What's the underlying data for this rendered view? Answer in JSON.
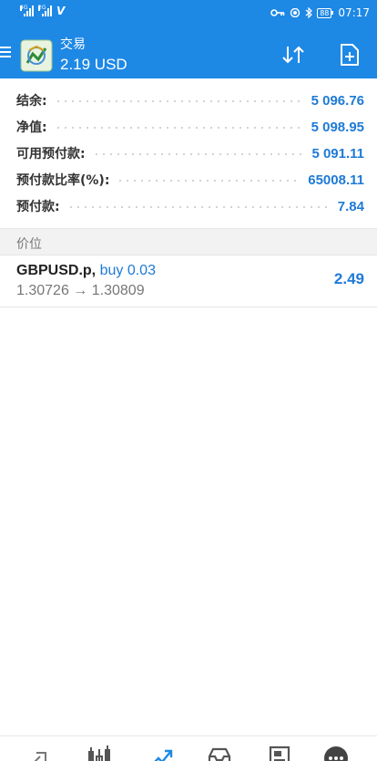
{
  "status_bar": {
    "signal_1_net": "4G",
    "signal_2_net": "2G",
    "battery": "88",
    "time": "07:17"
  },
  "toolbar": {
    "title": "交易",
    "balance": "2.19 USD",
    "color": "#1e88e5"
  },
  "summary": [
    {
      "label": "结余:",
      "value": "5 096.76"
    },
    {
      "label": "净值:",
      "value": "5 098.95"
    },
    {
      "label": "可用预付款:",
      "value": "5 091.11"
    },
    {
      "label": "预付款比率(%):",
      "value": "65008.11"
    },
    {
      "label": "预付款:",
      "value": "7.84"
    }
  ],
  "section": {
    "title": "价位"
  },
  "positions": [
    {
      "symbol": "GBPUSD.p,",
      "side": "buy 0.03",
      "price_open": "1.30726",
      "arrow": "→",
      "price_current": "1.30809",
      "profit": "2.49"
    }
  ],
  "bottom_nav": [
    {
      "icon": "quotes-icon"
    },
    {
      "icon": "chart-icon"
    },
    {
      "icon": "trade-icon"
    },
    {
      "icon": "history-icon"
    },
    {
      "icon": "news-icon"
    },
    {
      "icon": "more-icon"
    }
  ],
  "colors": {
    "accent": "#1e88e5",
    "value": "#1e7ad6"
  }
}
